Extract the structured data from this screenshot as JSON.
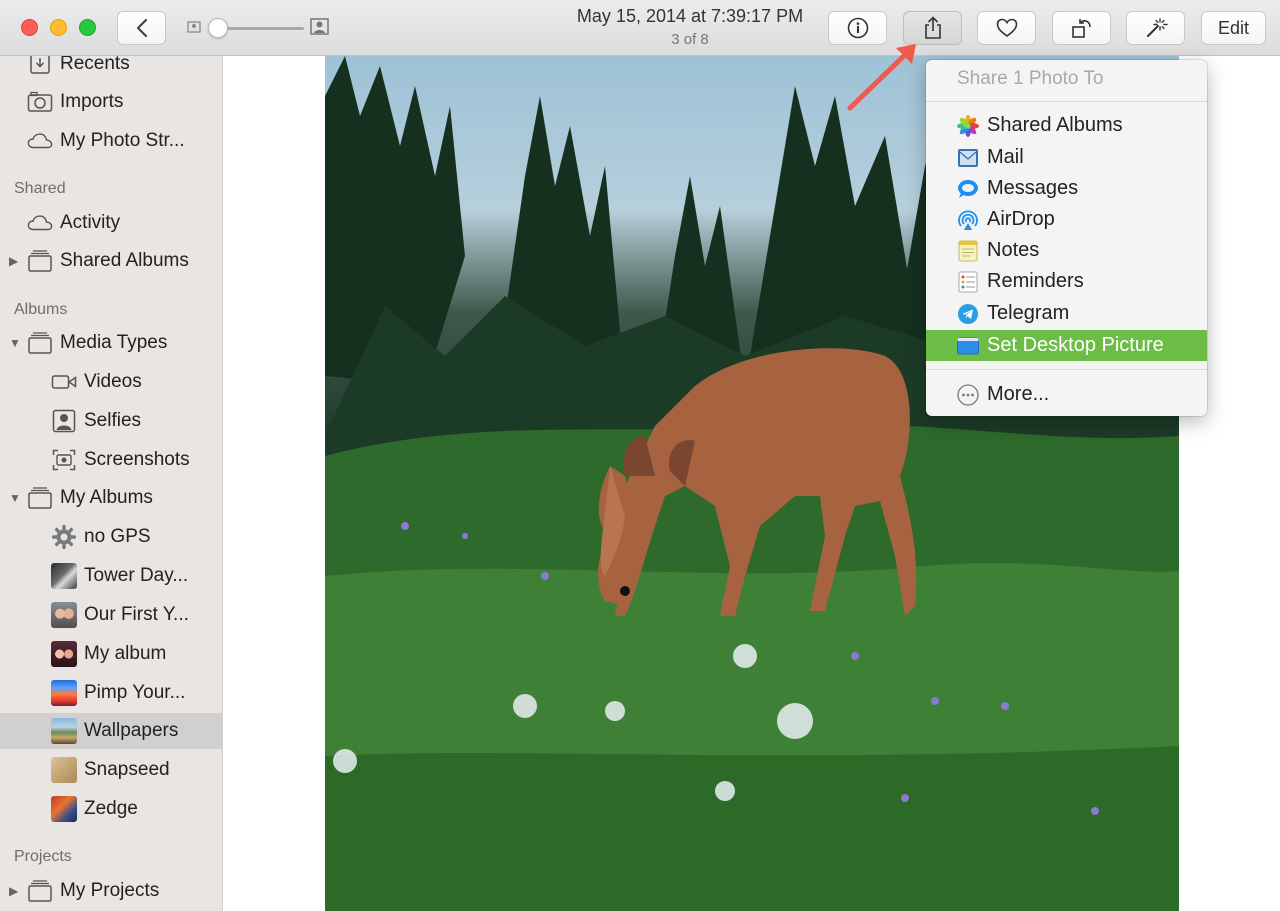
{
  "titlebar": {
    "date": "May 15, 2014 at 7:39:17 PM",
    "position": "3 of 8",
    "edit_label": "Edit"
  },
  "sidebar": {
    "top_items": [
      {
        "label": "Recents",
        "icon": "clock-icon"
      },
      {
        "label": "Imports",
        "icon": "camera-icon"
      },
      {
        "label": "My Photo Str...",
        "icon": "cloud-icon"
      }
    ],
    "shared_header": "Shared",
    "shared_items": [
      {
        "label": "Activity",
        "icon": "cloud-icon"
      },
      {
        "label": "Shared Albums",
        "icon": "album-stack-icon"
      }
    ],
    "albums_header": "Albums",
    "album_items": [
      {
        "label": "Media Types",
        "icon": "album-stack-icon"
      },
      {
        "label": "Videos",
        "icon": "video-icon"
      },
      {
        "label": "Selfies",
        "icon": "selfie-icon"
      },
      {
        "label": "Screenshots",
        "icon": "screenshot-icon"
      },
      {
        "label": "My Albums",
        "icon": "album-stack-icon"
      },
      {
        "label": "no GPS",
        "icon": "gear-icon"
      },
      {
        "label": "Tower Day...",
        "icon": "album-thumbnail"
      },
      {
        "label": "Our First Y...",
        "icon": "album-thumbnail"
      },
      {
        "label": "My album",
        "icon": "album-thumbnail"
      },
      {
        "label": "Pimp Your...",
        "icon": "album-thumbnail"
      },
      {
        "label": "Wallpapers",
        "icon": "album-thumbnail"
      },
      {
        "label": "Snapseed",
        "icon": "album-thumbnail"
      },
      {
        "label": "Zedge",
        "icon": "album-thumbnail"
      }
    ],
    "projects_header": "Projects",
    "project_items": [
      {
        "label": "My Projects",
        "icon": "album-stack-icon"
      }
    ]
  },
  "share_menu": {
    "header": "Share 1 Photo To",
    "items": [
      {
        "label": "Shared Albums",
        "icon": "photos-icon"
      },
      {
        "label": "Mail",
        "icon": "mail-icon"
      },
      {
        "label": "Messages",
        "icon": "messages-icon"
      },
      {
        "label": "AirDrop",
        "icon": "airdrop-icon"
      },
      {
        "label": "Notes",
        "icon": "notes-icon"
      },
      {
        "label": "Reminders",
        "icon": "reminders-icon"
      },
      {
        "label": "Telegram",
        "icon": "telegram-icon"
      },
      {
        "label": "Set Desktop Picture",
        "icon": "desktop-icon"
      }
    ],
    "more_label": "More...",
    "highlight_color": "#6cbc45"
  },
  "colors": {
    "annotation_arrow": "#f0594d",
    "sidebar_bg": "#e8e5e3",
    "selected_row": "#d2d0ce"
  }
}
